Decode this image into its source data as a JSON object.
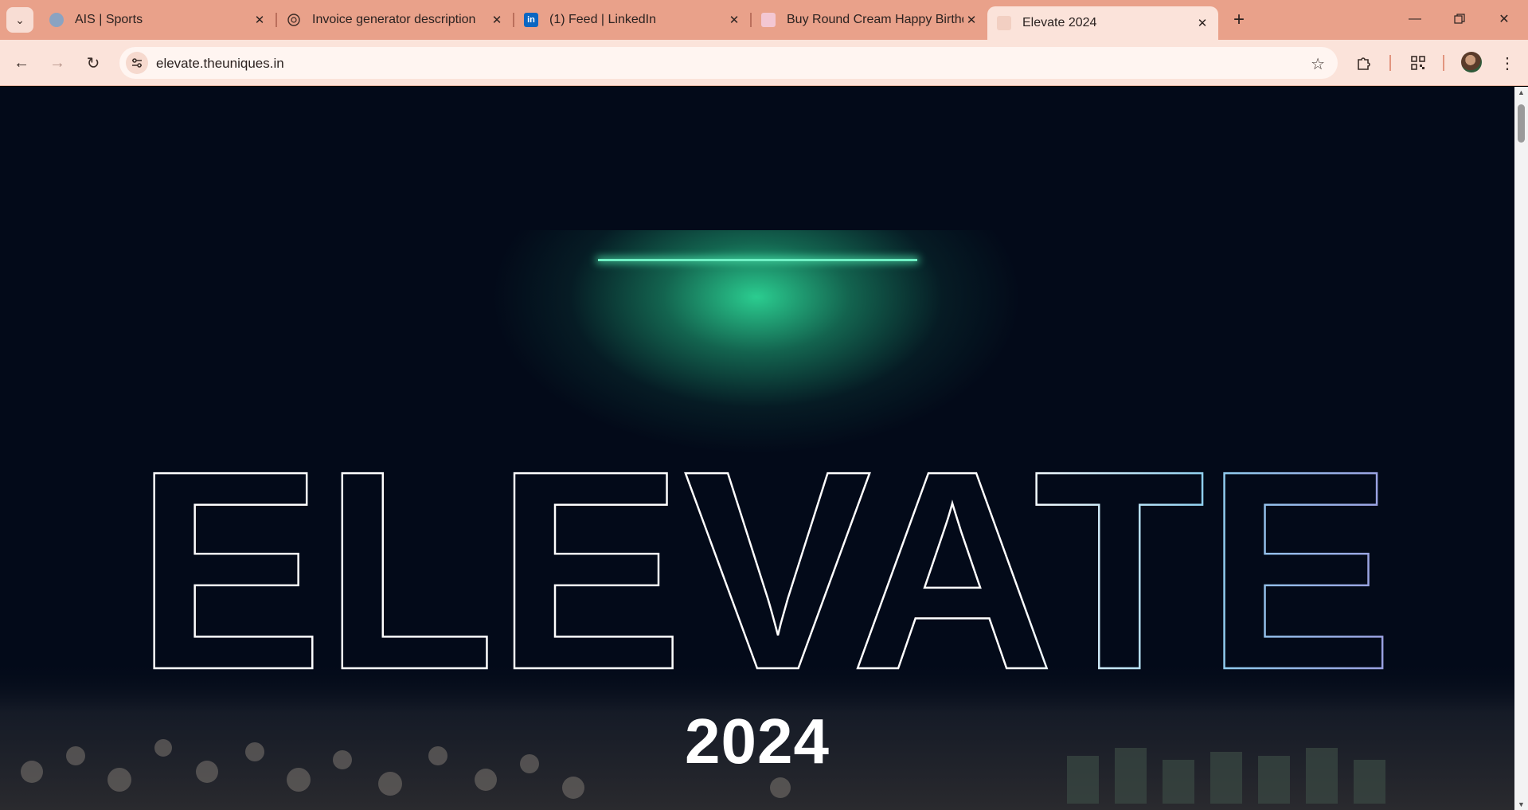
{
  "browser": {
    "tabs": [
      {
        "title": "AIS | Sports",
        "icon": "globe-icon",
        "active": false
      },
      {
        "title": "Invoice generator description",
        "icon": "openai-icon",
        "active": false
      },
      {
        "title": "(1) Feed | LinkedIn",
        "icon": "linkedin-icon",
        "active": false
      },
      {
        "title": "Buy Round Cream Happy Birthd",
        "icon": "shop-icon",
        "active": false
      },
      {
        "title": "Elevate 2024",
        "icon": "site-icon",
        "active": true
      }
    ],
    "new_tab_symbol": "+",
    "address": "elevate.theuniques.in",
    "colors": {
      "tabstrip": "#e9a18a",
      "toolbar": "#fbe3da",
      "page_bg": "#030a19",
      "glow": "#2dd796"
    }
  },
  "hero": {
    "headline": "ELEVATE",
    "year": "2024"
  }
}
